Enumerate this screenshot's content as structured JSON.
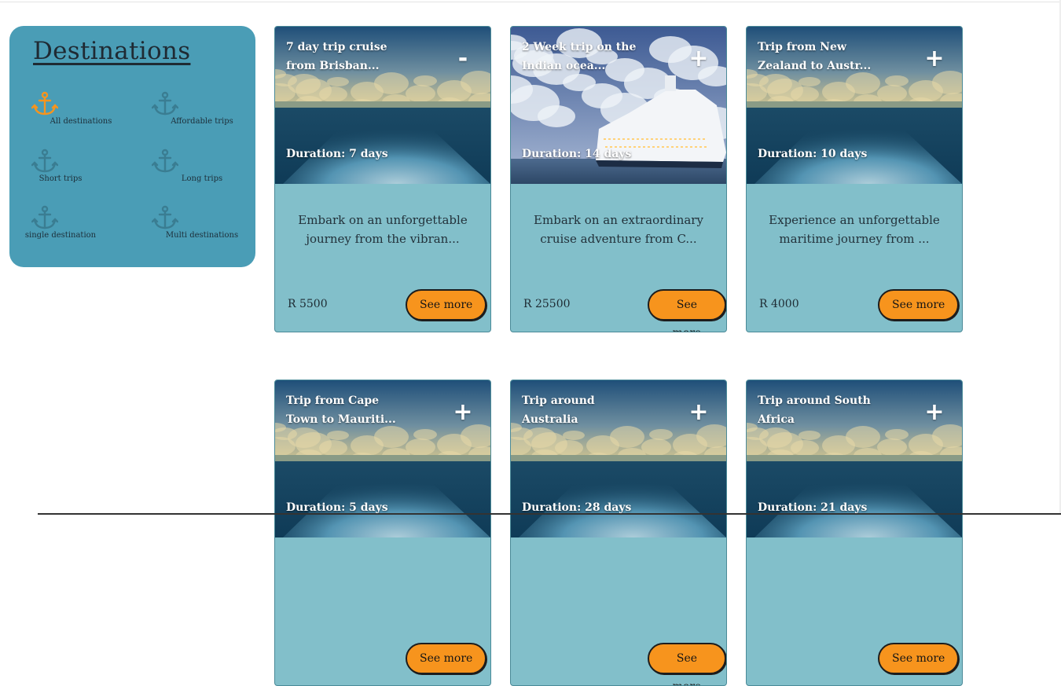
{
  "sidebar": {
    "title": "Destinations",
    "filters": [
      {
        "label": "All destinations",
        "icon": "anchor-icon",
        "active": true
      },
      {
        "label": "Affordable trips",
        "icon": "anchor-icon",
        "active": false
      },
      {
        "label": "Short trips",
        "icon": "anchor-icon",
        "active": false
      },
      {
        "label": "Long trips",
        "icon": "anchor-icon",
        "active": false
      },
      {
        "label": "single destination",
        "icon": "anchor-icon",
        "active": false
      },
      {
        "label": "Multi destinations",
        "icon": "anchor-icon",
        "active": false
      }
    ]
  },
  "cards": [
    {
      "title": "7 day trip cruise from Brisban...",
      "toggle": "-",
      "duration": "Duration: 7 days",
      "description": "Embark on an unforgettable journey from the vibran...",
      "price": "R 5500",
      "button": "See more",
      "image": "ocean-wake"
    },
    {
      "title": "2 Week trip on the Indian ocea...",
      "toggle": "+",
      "duration": "Duration: 14 days",
      "description": "Embark on an extraordinary cruise adventure from C...",
      "price": "R 25500",
      "button": "See more",
      "image": "cruise-ship"
    },
    {
      "title": "Trip from New Zealand to Austr...",
      "toggle": "+",
      "duration": "Duration: 10 days",
      "description": "Experience an unforgettable maritime journey from ...",
      "price": "R 4000",
      "button": "See more",
      "image": "ocean-wake"
    },
    {
      "title": "Trip from Cape Town to Mauriti...",
      "toggle": "+",
      "duration": "Duration: 5 days",
      "description": "",
      "price": "",
      "button": "See more",
      "image": "ocean-wake"
    },
    {
      "title": "Trip around Australia",
      "toggle": "+",
      "duration": "Duration: 28 days",
      "description": "",
      "price": "",
      "button": "See more",
      "image": "ocean-wake"
    },
    {
      "title": "Trip around South Africa",
      "toggle": "+",
      "duration": "Duration: 21 days",
      "description": "",
      "price": "",
      "button": "See more",
      "image": "ocean-wake"
    }
  ],
  "colors": {
    "sidebar_bg": "#4a9db6",
    "card_bg": "#82bfca",
    "accent": "#f7941d",
    "anchor_active": "#f7941d",
    "anchor_inactive": "#3a7d92"
  }
}
